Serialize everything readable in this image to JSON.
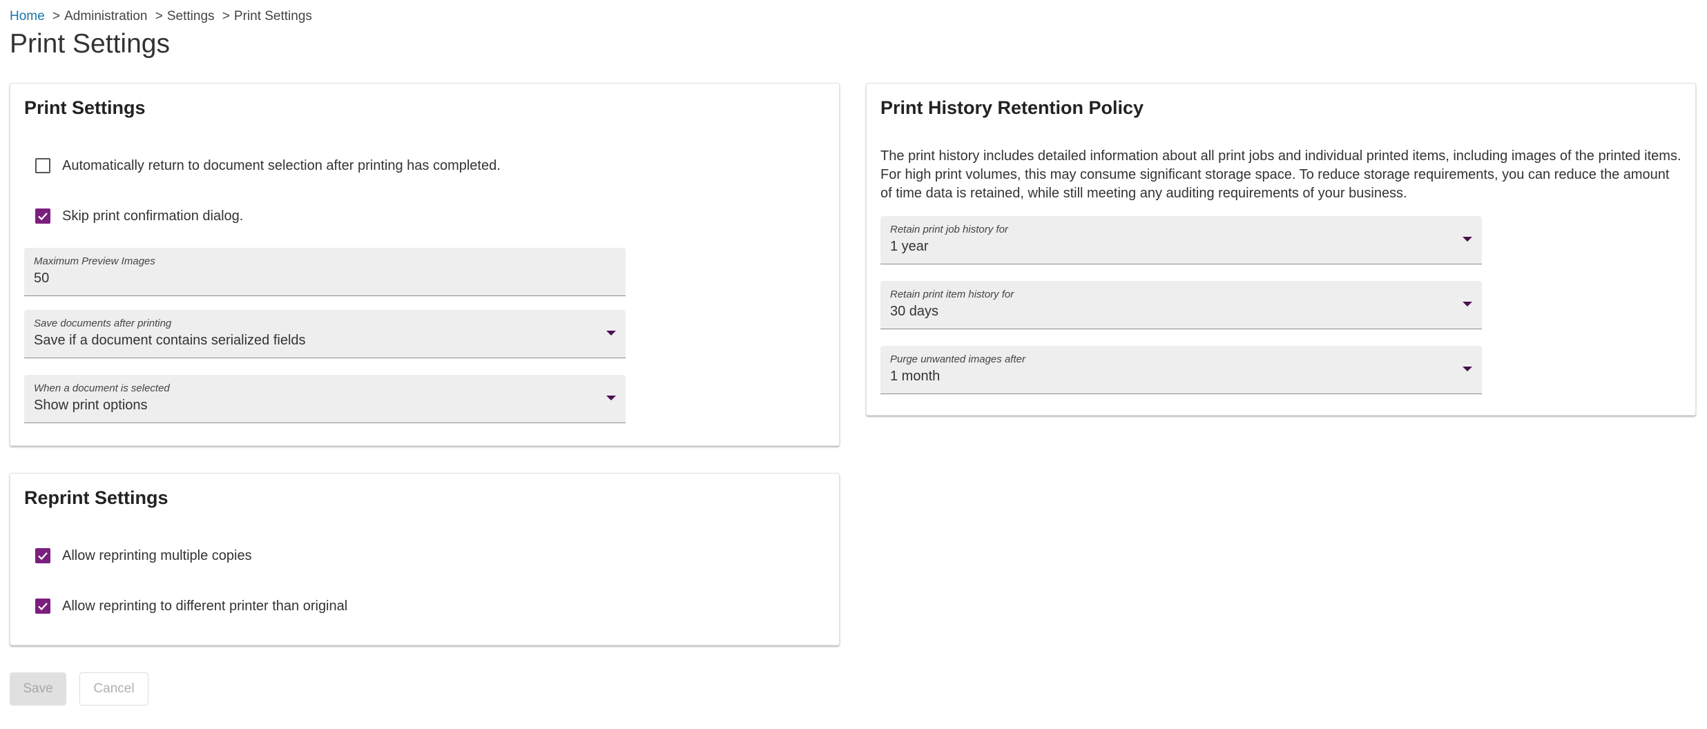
{
  "breadcrumb": {
    "home": "Home",
    "separator": ">",
    "items": [
      "Administration",
      "Settings",
      "Print Settings"
    ]
  },
  "page_title": "Print Settings",
  "print_settings": {
    "title": "Print Settings",
    "auto_return": {
      "label": "Automatically return to document selection after printing has completed.",
      "checked": false
    },
    "skip_confirmation": {
      "label": "Skip print confirmation dialog.",
      "checked": true
    },
    "max_preview_images": {
      "label": "Maximum Preview Images",
      "value": "50"
    },
    "save_documents": {
      "label": "Save documents after printing",
      "value": "Save if a document contains serialized fields"
    },
    "when_selected": {
      "label": "When a document is selected",
      "value": "Show print options"
    }
  },
  "reprint_settings": {
    "title": "Reprint Settings",
    "multiple_copies": {
      "label": "Allow reprinting multiple copies",
      "checked": true
    },
    "different_printer": {
      "label": "Allow reprinting to different printer than original",
      "checked": true
    }
  },
  "retention_policy": {
    "title": "Print History Retention Policy",
    "description": "The print history includes detailed information about all print jobs and individual printed items, including images of the printed items. For high print volumes, this may consume significant storage space. To reduce storage requirements, you can reduce the amount of time data is retained, while still meeting any auditing requirements of your business.",
    "job_history": {
      "label": "Retain print job history for",
      "value": "1 year"
    },
    "item_history": {
      "label": "Retain print item history for",
      "value": "30 days"
    },
    "purge_images": {
      "label": "Purge unwanted images after",
      "value": "1 month"
    }
  },
  "actions": {
    "save": "Save",
    "cancel": "Cancel"
  },
  "colors": {
    "accent": "#7b1f7e",
    "link": "#1a73a8",
    "field_bg": "#eeeeee"
  }
}
